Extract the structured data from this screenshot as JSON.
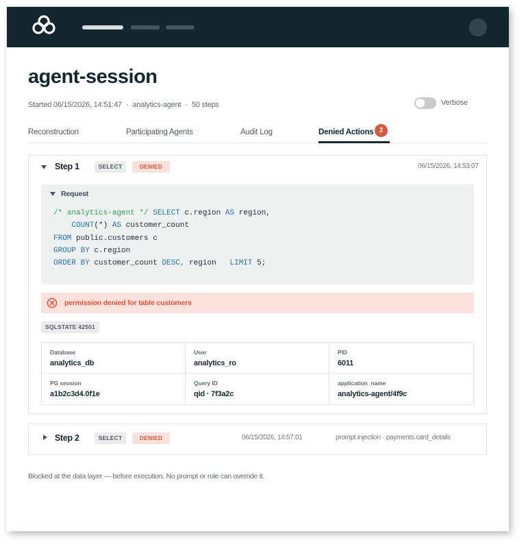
{
  "header": {
    "logo_icon": "cloud-logo-icon",
    "avatar_icon": "user-avatar-icon"
  },
  "page": {
    "title": "agent-session",
    "started": "Started 06/15/2026, 14:51:47",
    "agent": "analytics-agent",
    "steps": "50 steps",
    "separator": "·"
  },
  "verbose": {
    "label": "Verbose",
    "enabled": false
  },
  "tabs": [
    {
      "label": "Reconstruction",
      "active": false
    },
    {
      "label": "Participating Agents",
      "active": false
    },
    {
      "label": "Audit Log",
      "active": false
    },
    {
      "label": "Denied Actions",
      "active": true,
      "badge": "2"
    }
  ],
  "steps": [
    {
      "title": "Step 1",
      "operation": "SELECT",
      "status": "DENIED",
      "timestamp": "06/15/2026, 14:53:07",
      "expanded": true,
      "request": {
        "label": "Request",
        "code": {
          "comment": "/* analytics-agent */",
          "select": "SELECT",
          "col1": "c.region",
          "as1": "AS",
          "alias1": "region,",
          "count_fn": "COUNT",
          "count_arg": "(*)",
          "as2": "AS",
          "alias2": "customer_count",
          "from_kw": "FROM",
          "table": "public.customers c",
          "group_kw": "GROUP BY",
          "group_col": "c.region",
          "order_kw": "ORDER BY",
          "order_col": "customer_count",
          "desc_kw": "DESC,",
          "order_col2": "region",
          "limit_kw": "LIMIT",
          "limit_val": "5;"
        }
      },
      "error": "permission denied for table customers",
      "sqlstate": "SQLSTATE 42501",
      "details": [
        {
          "label": "Database",
          "value": "analytics_db"
        },
        {
          "label": "User",
          "value": "analytics_ro"
        },
        {
          "label": "PID",
          "value": "6011"
        },
        {
          "label": "PG session",
          "value": "a1b2c3d4.0f1e"
        },
        {
          "label": "Query ID",
          "value": "qid · 7f3a2c"
        },
        {
          "label": "application_name",
          "value": "analytics-agent/4f9c"
        }
      ]
    },
    {
      "title": "Step 2",
      "operation": "SELECT",
      "status": "DENIED",
      "timestamp": "06/15/2026, 14:57:01",
      "note": "prompt injection · payments.card_details",
      "expanded": false
    }
  ],
  "footer": {
    "note": "Blocked at the data layer — before execution. No prompt or role can override it."
  },
  "colors": {
    "header_bg": "#14272f",
    "accent_danger": "#d9563e",
    "danger_bg": "#fbe1dc",
    "code_keyword": "#2a6fa3",
    "code_comment": "#2f9e57"
  }
}
